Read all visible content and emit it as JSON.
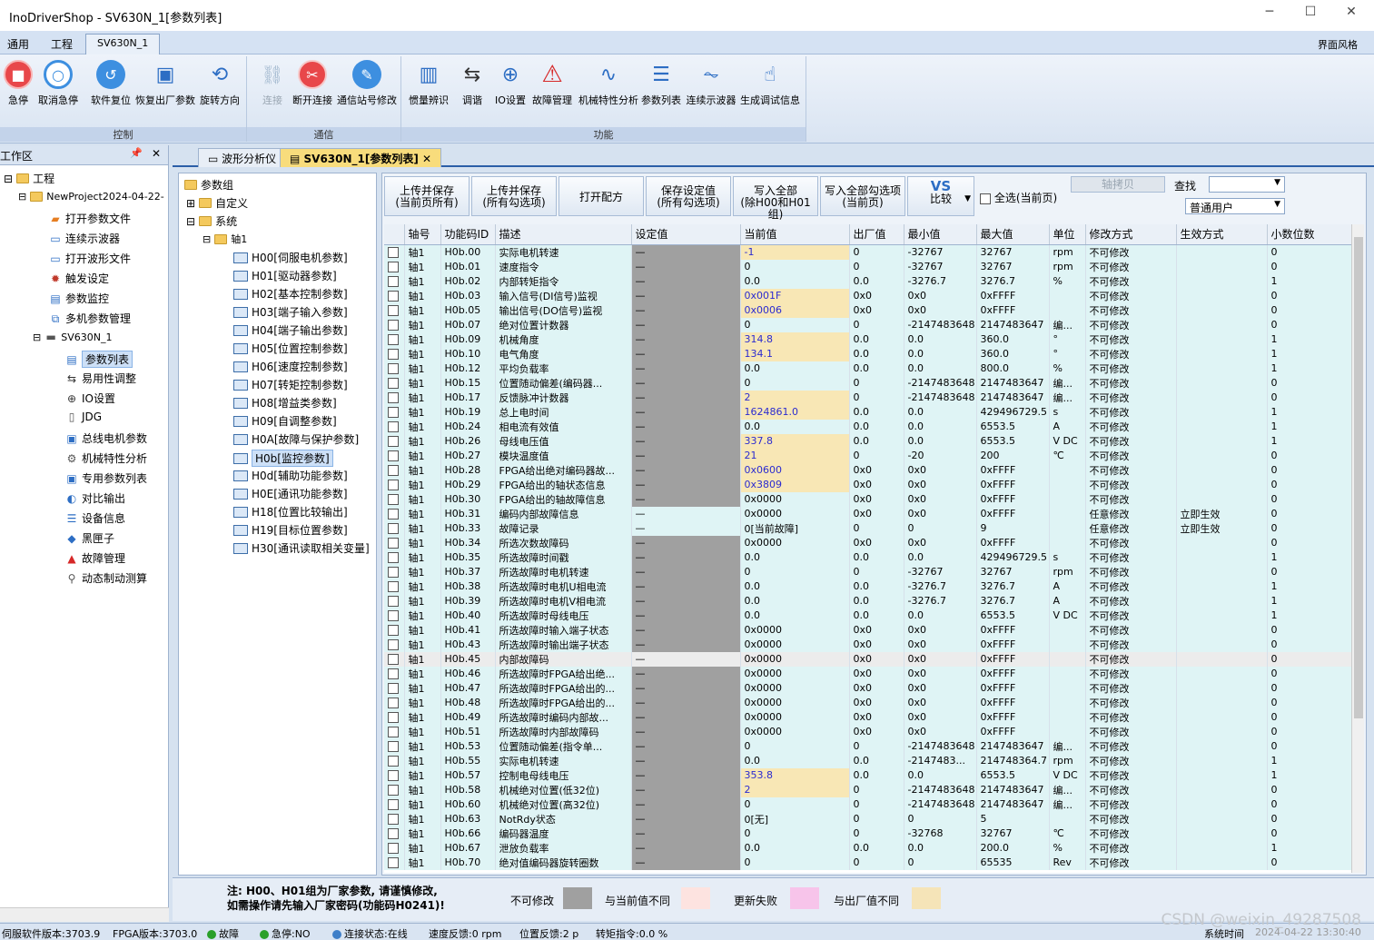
{
  "window": {
    "title": "InoDriverShop - SV630N_1[参数列表]"
  },
  "menu": {
    "items": [
      "通用",
      "工程",
      "SV630N_1"
    ],
    "style_label": "界面风格"
  },
  "ribbon": {
    "groups": [
      {
        "label": "控制",
        "buttons": [
          "急停",
          "取消急停",
          "软件复位",
          "恢复出厂参数",
          "旋转方向"
        ]
      },
      {
        "label": "通信",
        "buttons": [
          "连接",
          "断开连接",
          "通信站号修改"
        ]
      },
      {
        "label": "功能",
        "buttons": [
          "惯量辨识",
          "调谐",
          "IO设置",
          "故障管理",
          "机械特性分析",
          "参数列表",
          "连续示波器",
          "生成调试信息"
        ]
      }
    ]
  },
  "workspace": {
    "title": "工作区",
    "root": "工程",
    "project": "NewProject2024-04-22-",
    "items": [
      "打开参数文件",
      "连续示波器",
      "打开波形文件",
      "触发设定",
      "参数监控",
      "多机参数管理"
    ],
    "device": "SV630N_1",
    "device_items": [
      "参数列表",
      "易用性调整",
      "IO设置",
      "JDG",
      "总线电机参数",
      "机械特性分析",
      "专用参数列表",
      "对比输出",
      "设备信息",
      "黑匣子",
      "故障管理",
      "动态制动测算"
    ]
  },
  "tabs": [
    "波形分析仪",
    "SV630N_1[参数列表]"
  ],
  "group_tree": {
    "root": "参数组",
    "custom": "自定义",
    "system": "系统",
    "axis": "轴1",
    "groups": [
      "H00[伺服电机参数]",
      "H01[驱动器参数]",
      "H02[基本控制参数]",
      "H03[端子输入参数]",
      "H04[端子输出参数]",
      "H05[位置控制参数]",
      "H06[速度控制参数]",
      "H07[转矩控制参数]",
      "H08[增益类参数]",
      "H09[自调整参数]",
      "H0A[故障与保护参数]",
      "H0b[监控参数]",
      "H0d[辅助功能参数]",
      "H0E[通讯功能参数]",
      "H18[位置比较输出]",
      "H19[目标位置参数]",
      "H30[通讯读取相关变量]"
    ]
  },
  "toolbar": {
    "buttons": [
      {
        "l1": "上传并保存",
        "l2": "(当前页所有)"
      },
      {
        "l1": "上传并保存",
        "l2": "(所有勾选项)"
      },
      {
        "l1": "打开配方",
        "l2": ""
      },
      {
        "l1": "保存设定值",
        "l2": "(所有勾选项)"
      },
      {
        "l1": "写入全部",
        "l2": "(除H00和H01组)"
      },
      {
        "l1": "写入全部勾选项",
        "l2": "(当前页)"
      }
    ],
    "compare_top": "VS",
    "compare_label": "比较",
    "select_all": "全选(当前页)",
    "axis_copy": "轴拷贝",
    "find_label": "查找",
    "user": "普通用户"
  },
  "grid": {
    "headers": [
      "轴号",
      "功能码ID",
      "描述",
      "设定值",
      "当前值",
      "出厂值",
      "最小值",
      "最大值",
      "单位",
      "修改方式",
      "生效方式",
      "小数位数"
    ],
    "rows": [
      [
        "轴1",
        "H0b.00",
        "实际电机转速",
        "—",
        "-1",
        "0",
        "-32767",
        "32767",
        "rpm",
        "不可修改",
        "",
        "0"
      ],
      [
        "轴1",
        "H0b.01",
        "速度指令",
        "—",
        "0",
        "0",
        "-32767",
        "32767",
        "rpm",
        "不可修改",
        "",
        "0"
      ],
      [
        "轴1",
        "H0b.02",
        "内部转矩指令",
        "—",
        "0.0",
        "0.0",
        "-3276.7",
        "3276.7",
        "%",
        "不可修改",
        "",
        "1"
      ],
      [
        "轴1",
        "H0b.03",
        "输入信号(DI信号)监视",
        "—",
        "0x001F",
        "0x0",
        "0x0",
        "0xFFFF",
        "",
        "不可修改",
        "",
        "0"
      ],
      [
        "轴1",
        "H0b.05",
        "输出信号(DO信号)监视",
        "—",
        "0x0006",
        "0x0",
        "0x0",
        "0xFFFF",
        "",
        "不可修改",
        "",
        "0"
      ],
      [
        "轴1",
        "H0b.07",
        "绝对位置计数器",
        "—",
        "0",
        "0",
        "-2147483648",
        "2147483647",
        "编...",
        "不可修改",
        "",
        "0"
      ],
      [
        "轴1",
        "H0b.09",
        "机械角度",
        "—",
        "314.8",
        "0.0",
        "0.0",
        "360.0",
        "°",
        "不可修改",
        "",
        "1"
      ],
      [
        "轴1",
        "H0b.10",
        "电气角度",
        "—",
        "134.1",
        "0.0",
        "0.0",
        "360.0",
        "°",
        "不可修改",
        "",
        "1"
      ],
      [
        "轴1",
        "H0b.12",
        "平均负载率",
        "—",
        "0.0",
        "0.0",
        "0.0",
        "800.0",
        "%",
        "不可修改",
        "",
        "1"
      ],
      [
        "轴1",
        "H0b.15",
        "位置随动偏差(编码器...",
        "—",
        "0",
        "0",
        "-2147483648",
        "2147483647",
        "编...",
        "不可修改",
        "",
        "0"
      ],
      [
        "轴1",
        "H0b.17",
        "反馈脉冲计数器",
        "—",
        "2",
        "0",
        "-2147483648",
        "2147483647",
        "编...",
        "不可修改",
        "",
        "0"
      ],
      [
        "轴1",
        "H0b.19",
        "总上电时间",
        "—",
        "1624861.0",
        "0.0",
        "0.0",
        "429496729.5",
        "s",
        "不可修改",
        "",
        "1"
      ],
      [
        "轴1",
        "H0b.24",
        "相电流有效值",
        "—",
        "0.0",
        "0.0",
        "0.0",
        "6553.5",
        "A",
        "不可修改",
        "",
        "1"
      ],
      [
        "轴1",
        "H0b.26",
        "母线电压值",
        "—",
        "337.8",
        "0.0",
        "0.0",
        "6553.5",
        "V DC",
        "不可修改",
        "",
        "1"
      ],
      [
        "轴1",
        "H0b.27",
        "模块温度值",
        "—",
        "21",
        "0",
        "-20",
        "200",
        "℃",
        "不可修改",
        "",
        "0"
      ],
      [
        "轴1",
        "H0b.28",
        "FPGA给出绝对编码器故...",
        "—",
        "0x0600",
        "0x0",
        "0x0",
        "0xFFFF",
        "",
        "不可修改",
        "",
        "0"
      ],
      [
        "轴1",
        "H0b.29",
        "FPGA给出的轴状态信息",
        "—",
        "0x3809",
        "0x0",
        "0x0",
        "0xFFFF",
        "",
        "不可修改",
        "",
        "0"
      ],
      [
        "轴1",
        "H0b.30",
        "FPGA给出的轴故障信息",
        "—",
        "0x0000",
        "0x0",
        "0x0",
        "0xFFFF",
        "",
        "不可修改",
        "",
        "0"
      ],
      [
        "轴1",
        "H0b.31",
        "编码内部故障信息",
        "—",
        "0x0000",
        "0x0",
        "0x0",
        "0xFFFF",
        "",
        "任意修改",
        "立即生效",
        "0"
      ],
      [
        "轴1",
        "H0b.33",
        "故障记录",
        "—",
        "0[当前故障]",
        "0",
        "0",
        "9",
        "",
        "任意修改",
        "立即生效",
        "0"
      ],
      [
        "轴1",
        "H0b.34",
        "所选次数故障码",
        "—",
        "0x0000",
        "0x0",
        "0x0",
        "0xFFFF",
        "",
        "不可修改",
        "",
        "0"
      ],
      [
        "轴1",
        "H0b.35",
        "所选故障时间戳",
        "—",
        "0.0",
        "0.0",
        "0.0",
        "429496729.5",
        "s",
        "不可修改",
        "",
        "1"
      ],
      [
        "轴1",
        "H0b.37",
        "所选故障时电机转速",
        "—",
        "0",
        "0",
        "-32767",
        "32767",
        "rpm",
        "不可修改",
        "",
        "0"
      ],
      [
        "轴1",
        "H0b.38",
        "所选故障时电机U相电流",
        "—",
        "0.0",
        "0.0",
        "-3276.7",
        "3276.7",
        "A",
        "不可修改",
        "",
        "1"
      ],
      [
        "轴1",
        "H0b.39",
        "所选故障时电机V相电流",
        "—",
        "0.0",
        "0.0",
        "-3276.7",
        "3276.7",
        "A",
        "不可修改",
        "",
        "1"
      ],
      [
        "轴1",
        "H0b.40",
        "所选故障时母线电压",
        "—",
        "0.0",
        "0.0",
        "0.0",
        "6553.5",
        "V DC",
        "不可修改",
        "",
        "1"
      ],
      [
        "轴1",
        "H0b.41",
        "所选故障时输入端子状态",
        "—",
        "0x0000",
        "0x0",
        "0x0",
        "0xFFFF",
        "",
        "不可修改",
        "",
        "0"
      ],
      [
        "轴1",
        "H0b.43",
        "所选故障时输出端子状态",
        "—",
        "0x0000",
        "0x0",
        "0x0",
        "0xFFFF",
        "",
        "不可修改",
        "",
        "0"
      ],
      [
        "轴1",
        "H0b.45",
        "内部故障码",
        "—",
        "0x0000",
        "0x0",
        "0x0",
        "0xFFFF",
        "",
        "不可修改",
        "",
        "0"
      ],
      [
        "轴1",
        "H0b.46",
        "所选故障时FPGA给出绝...",
        "—",
        "0x0000",
        "0x0",
        "0x0",
        "0xFFFF",
        "",
        "不可修改",
        "",
        "0"
      ],
      [
        "轴1",
        "H0b.47",
        "所选故障时FPGA给出的...",
        "—",
        "0x0000",
        "0x0",
        "0x0",
        "0xFFFF",
        "",
        "不可修改",
        "",
        "0"
      ],
      [
        "轴1",
        "H0b.48",
        "所选故障时FPGA给出的...",
        "—",
        "0x0000",
        "0x0",
        "0x0",
        "0xFFFF",
        "",
        "不可修改",
        "",
        "0"
      ],
      [
        "轴1",
        "H0b.49",
        "所选故障时编码内部故...",
        "—",
        "0x0000",
        "0x0",
        "0x0",
        "0xFFFF",
        "",
        "不可修改",
        "",
        "0"
      ],
      [
        "轴1",
        "H0b.51",
        "所选故障时内部故障码",
        "—",
        "0x0000",
        "0x0",
        "0x0",
        "0xFFFF",
        "",
        "不可修改",
        "",
        "0"
      ],
      [
        "轴1",
        "H0b.53",
        "位置随动偏差(指令单...",
        "—",
        "0",
        "0",
        "-2147483648",
        "2147483647",
        "编...",
        "不可修改",
        "",
        "0"
      ],
      [
        "轴1",
        "H0b.55",
        "实际电机转速",
        "—",
        "0.0",
        "0.0",
        "-2147483...",
        "214748364.7",
        "rpm",
        "不可修改",
        "",
        "1"
      ],
      [
        "轴1",
        "H0b.57",
        "控制电母线电压",
        "—",
        "353.8",
        "0.0",
        "0.0",
        "6553.5",
        "V DC",
        "不可修改",
        "",
        "1"
      ],
      [
        "轴1",
        "H0b.58",
        "机械绝对位置(低32位)",
        "—",
        "2",
        "0",
        "-2147483648",
        "2147483647",
        "编...",
        "不可修改",
        "",
        "0"
      ],
      [
        "轴1",
        "H0b.60",
        "机械绝对位置(高32位)",
        "—",
        "0",
        "0",
        "-2147483648",
        "2147483647",
        "编...",
        "不可修改",
        "",
        "0"
      ],
      [
        "轴1",
        "H0b.63",
        "NotRdy状态",
        "—",
        "0[无]",
        "0",
        "0",
        "5",
        "",
        "不可修改",
        "",
        "0"
      ],
      [
        "轴1",
        "H0b.66",
        "编码器温度",
        "—",
        "0",
        "0",
        "-32768",
        "32767",
        "℃",
        "不可修改",
        "",
        "0"
      ],
      [
        "轴1",
        "H0b.67",
        "泄放负载率",
        "—",
        "0.0",
        "0.0",
        "0.0",
        "200.0",
        "%",
        "不可修改",
        "",
        "1"
      ],
      [
        "轴1",
        "H0b.70",
        "绝对值编码器旋转圈数",
        "—",
        "0",
        "0",
        "0",
        "65535",
        "Rev",
        "不可修改",
        "",
        "0"
      ]
    ]
  },
  "footer": {
    "note1": "注: H00、H01组为厂家参数, 请谨慎修改,",
    "note2": "如需操作请先输入厂家密码(功能码H0241)!",
    "legend": [
      {
        "label": "不可修改",
        "color": "#a0a0a0"
      },
      {
        "label": "与当前值不同",
        "color": "#fde3e0"
      },
      {
        "label": "更新失败",
        "color": "#f7c4ea"
      },
      {
        "label": "与出厂值不同",
        "color": "#f5e4b8"
      }
    ]
  },
  "statusbar": {
    "items": [
      "伺服软件版本:3703.9",
      "FPGA版本:3703.0",
      "故障",
      "急停:NO",
      "连接状态:在线",
      "速度反馈:0 rpm",
      "位置反馈:2 p",
      "转矩指令:0.0 %"
    ],
    "sys_time": "系统时间",
    "datetime": "2024-04-22 13:30:40"
  },
  "watermark": "CSDN @weixin_49287508"
}
